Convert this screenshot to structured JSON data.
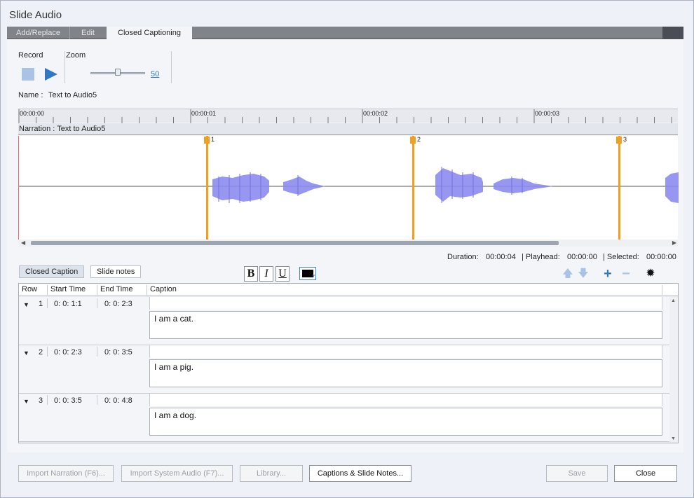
{
  "window": {
    "title": "Slide Audio"
  },
  "tabs": [
    {
      "label": "Add/Replace"
    },
    {
      "label": "Edit"
    },
    {
      "label": "Closed Captioning"
    }
  ],
  "record": {
    "label": "Record"
  },
  "zoom": {
    "label": "Zoom",
    "value": "50",
    "level": 50
  },
  "name_label": "Name :",
  "name_value": "Text to Audio5",
  "ruler": {
    "ticks": [
      "00:00:00",
      "00:00:01",
      "00:00:02",
      "00:00:03"
    ]
  },
  "narration": {
    "label": "Narration : Text to Audio5"
  },
  "markers": [
    "1",
    "2",
    "3"
  ],
  "status": {
    "duration_label": "Duration:",
    "duration_value": "00:00:04",
    "playhead_label": "| Playhead:",
    "playhead_value": "00:00:00",
    "selected_label": "| Selected:",
    "selected_value": "00:00:00"
  },
  "panel_tabs": [
    {
      "label": "Closed Caption"
    },
    {
      "label": "Slide notes"
    }
  ],
  "format": {
    "bold": "B",
    "italic": "I",
    "underline": "U"
  },
  "grid": {
    "headers": {
      "row": "Row",
      "start": "Start Time",
      "end": "End Time",
      "caption": "Caption"
    },
    "rows": [
      {
        "num": "1",
        "start": "0: 0: 1:1",
        "end": "0: 0: 2:3",
        "caption": "I am a cat."
      },
      {
        "num": "2",
        "start": "0: 0: 2:3",
        "end": "0: 0: 3:5",
        "caption": "I am a pig."
      },
      {
        "num": "3",
        "start": "0: 0: 3:5",
        "end": "0: 0: 4:8",
        "caption": "I am a dog."
      }
    ]
  },
  "buttons": {
    "import_narration": "Import Narration (F6)...",
    "import_system": "Import System Audio (F7)...",
    "library": "Library...",
    "captions_notes": "Captions & Slide Notes...",
    "save": "Save",
    "close": "Close"
  },
  "colors": {
    "accent": "#2f79c4",
    "marker": "#f0a020",
    "waveform": "#8c8cf0"
  }
}
